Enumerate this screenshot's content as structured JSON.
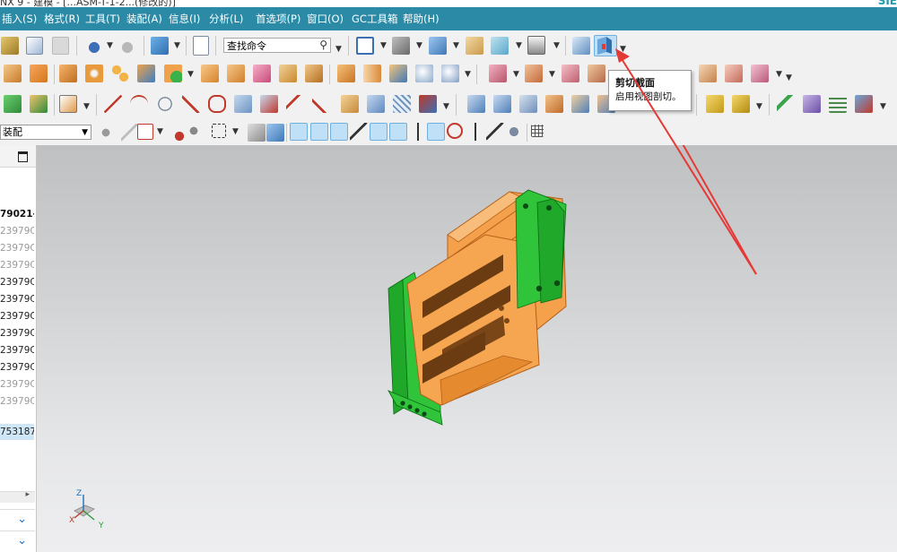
{
  "window": {
    "title": "NX 9 - 建模 - [...ASM-T-1-2...(修改的)]",
    "brand": "SIE"
  },
  "menu": {
    "items": [
      "插入(S)",
      "格式(R)",
      "工具(T)",
      "装配(A)",
      "信息(I)",
      "分析(L)",
      "首选项(P)",
      "窗口(O)",
      "GC工具箱",
      "帮助(H)"
    ]
  },
  "toolbar": {
    "command_finder_placeholder": "查找命令",
    "assembly_filter": "装配"
  },
  "tooltip": {
    "title": "剪切截面",
    "description": "启用视图剖切。"
  },
  "navigator": {
    "rows": [
      "79021-",
      "23979C",
      "23979C",
      "23979C",
      "23979C",
      "23979C",
      "23979C",
      "23979C",
      "23979C",
      "23979C",
      "23979C",
      "23979C",
      "753187"
    ]
  },
  "viewport": {
    "triad_labels": [
      "Z",
      "X",
      "Y"
    ]
  },
  "colors": {
    "menubar": "#2b8aa6",
    "part_orange": "#f5a04a",
    "part_green": "#38c93a",
    "annotation_arrow": "#e53935",
    "highlight": "#bfe0f6"
  }
}
